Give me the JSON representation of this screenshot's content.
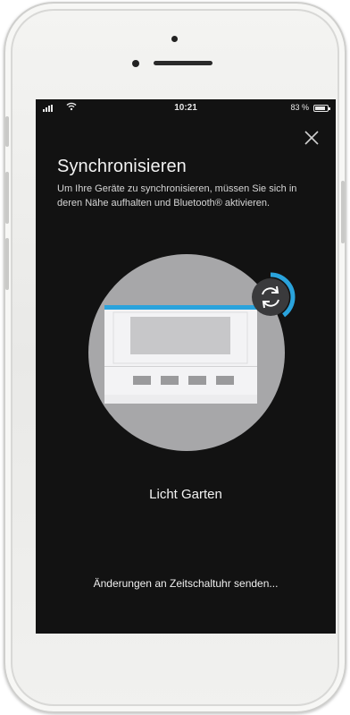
{
  "statusbar": {
    "time": "10:21",
    "battery_text": "83 %",
    "battery_level": 0.83,
    "signal_icon": "cellular-signal-icon",
    "wifi_icon": "wifi-icon"
  },
  "dialog": {
    "close_icon": "close-icon",
    "title": "Synchronisieren",
    "description": "Um Ihre Geräte zu synchronisieren, müssen Sie sich in deren Nähe aufhalten und Bluetooth® aktivieren.",
    "device_name": "Licht Garten",
    "status_message": "Änderungen an Zeitschaltuhr senden..."
  },
  "illustration": {
    "device_icon": "timer-device-icon",
    "sync_icon": "sync-icon",
    "sync_progress": 0.4
  },
  "colors": {
    "screen_background": "#121212",
    "accent": "#2aa3dc",
    "circle": "#a7a7a9",
    "device_panel": "#f3f3f5"
  }
}
